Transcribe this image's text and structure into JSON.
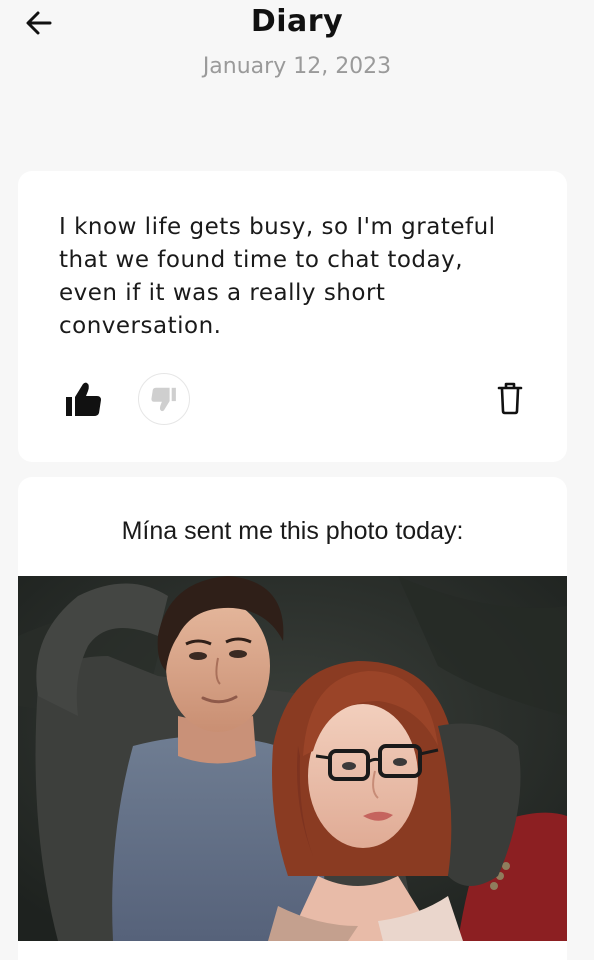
{
  "header": {
    "title": "Diary",
    "date": "January 12, 2023"
  },
  "entry": {
    "text": "I know life gets busy, so I'm grateful that we found time to chat today, even if it was a really short conversation."
  },
  "photo_entry": {
    "caption": "Mína sent me this photo today:"
  },
  "colors": {
    "background": "#f7f7f7",
    "card": "#ffffff",
    "date_text": "#9a9a9a"
  }
}
